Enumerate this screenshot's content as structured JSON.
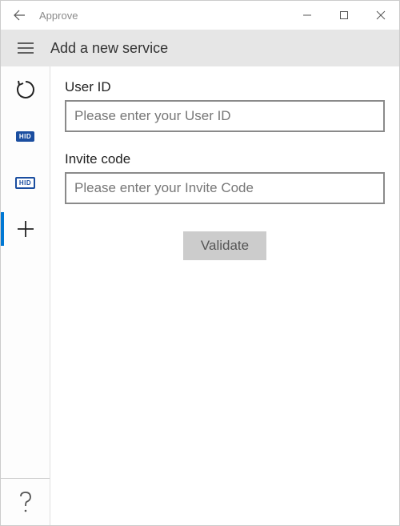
{
  "window": {
    "title": "Approve"
  },
  "header": {
    "subtitle": "Add a new service"
  },
  "form": {
    "user_id_label": "User ID",
    "user_id_placeholder": "Please enter your User ID",
    "invite_code_label": "Invite code",
    "invite_code_placeholder": "Please enter your Invite Code",
    "validate_label": "Validate"
  },
  "sidebar": {
    "hid_label_1": "HID",
    "hid_label_2": "HID"
  }
}
